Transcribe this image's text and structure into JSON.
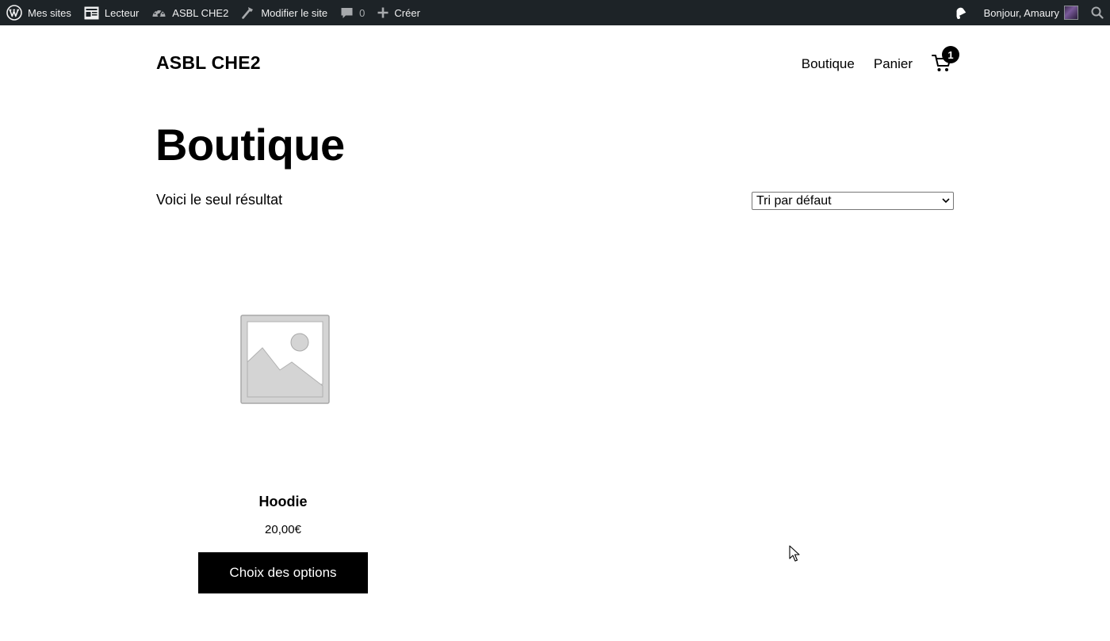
{
  "adminbar": {
    "items": [
      {
        "label": "Mes sites",
        "icon": "wordpress-icon"
      },
      {
        "label": "Lecteur",
        "icon": "reader-icon"
      },
      {
        "label": "ASBL CHE2",
        "icon": "dashboard-icon"
      },
      {
        "label": "Modifier le site",
        "icon": "hammer-icon"
      },
      {
        "label": "0",
        "icon": "comment-icon"
      },
      {
        "label": "Créer",
        "icon": "plus-icon"
      }
    ],
    "greeting": "Bonjour, Amaury",
    "colors": {
      "background": "#1d2327",
      "text": "#f0f0f1"
    }
  },
  "header": {
    "site_title": "ASBL CHE2",
    "nav": [
      "Boutique",
      "Panier"
    ],
    "cart_count": "1"
  },
  "main": {
    "page_title": "Boutique",
    "result_count": "Voici le seul résultat",
    "sort": {
      "selected": "Tri par défaut"
    }
  },
  "products": [
    {
      "name": "Hoodie",
      "price": "20,00€",
      "button_label": "Choix des options"
    }
  ]
}
